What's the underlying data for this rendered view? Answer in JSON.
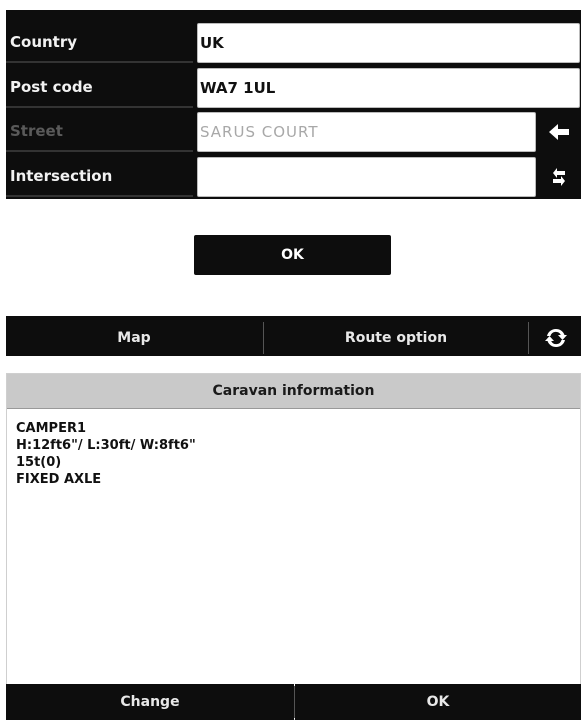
{
  "address_form": {
    "rows": [
      {
        "label": "Country",
        "value": ""
      },
      {
        "label": "Post code",
        "value": "WA7 1UL"
      },
      {
        "label": "Street",
        "value": "SARUS COURT"
      },
      {
        "label": "Intersection",
        "value": ""
      }
    ],
    "country_value": "UK",
    "ok_label": "OK",
    "back_icon": "arrow-left-icon",
    "swap_icon": "swap-arrows-icon"
  },
  "bottom_bar": {
    "map_label": "Map",
    "route_option_label": "Route option",
    "refresh_icon": "refresh-icon"
  },
  "caravan_info": {
    "title": "Caravan information",
    "lines": [
      "CAMPER1",
      "H:12ft6\"/ L:30ft/ W:8ft6\"",
      "15t(0)",
      "FIXED AXLE"
    ],
    "change_label": "Change",
    "ok_label": "OK"
  },
  "colors": {
    "bar_background": "#0d0d0d",
    "header_background": "#c9c9c9",
    "disabled_text": "#a8a8a8"
  }
}
